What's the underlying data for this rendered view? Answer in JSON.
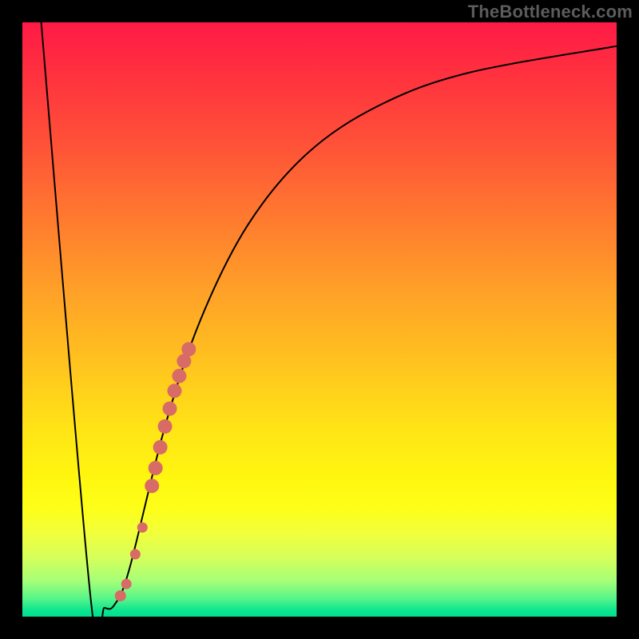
{
  "watermark": "TheBottleneck.com",
  "chart_data": {
    "type": "line",
    "title": "",
    "xlabel": "",
    "ylabel": "",
    "x_range": [
      0,
      100
    ],
    "y_range": [
      0,
      100
    ],
    "curve": [
      {
        "x": 3.0,
        "y": 102.0
      },
      {
        "x": 11.5,
        "y": 3.0
      },
      {
        "x": 13.8,
        "y": 1.5
      },
      {
        "x": 15.5,
        "y": 2.0
      },
      {
        "x": 18.0,
        "y": 8.0
      },
      {
        "x": 24.0,
        "y": 32.0
      },
      {
        "x": 30.0,
        "y": 50.0
      },
      {
        "x": 38.0,
        "y": 66.0
      },
      {
        "x": 48.0,
        "y": 78.0
      },
      {
        "x": 60.0,
        "y": 86.0
      },
      {
        "x": 75.0,
        "y": 91.5
      },
      {
        "x": 100.0,
        "y": 96.0
      }
    ],
    "markers": [
      {
        "x": 16.5,
        "y": 3.5,
        "r": 1.4
      },
      {
        "x": 17.5,
        "y": 5.5,
        "r": 1.3
      },
      {
        "x": 19.0,
        "y": 10.5,
        "r": 1.3
      },
      {
        "x": 20.2,
        "y": 15.0,
        "r": 1.3
      },
      {
        "x": 21.8,
        "y": 22.0,
        "r": 1.8
      },
      {
        "x": 22.4,
        "y": 25.0,
        "r": 1.8
      },
      {
        "x": 23.2,
        "y": 28.5,
        "r": 1.8
      },
      {
        "x": 24.0,
        "y": 32.0,
        "r": 1.8
      },
      {
        "x": 24.8,
        "y": 35.0,
        "r": 1.8
      },
      {
        "x": 25.6,
        "y": 38.0,
        "r": 1.8
      },
      {
        "x": 26.4,
        "y": 40.5,
        "r": 1.8
      },
      {
        "x": 27.2,
        "y": 43.0,
        "r": 1.8
      },
      {
        "x": 28.0,
        "y": 45.0,
        "r": 1.8
      }
    ],
    "marker_color": "#d86b66",
    "curve_color": "#000000"
  }
}
